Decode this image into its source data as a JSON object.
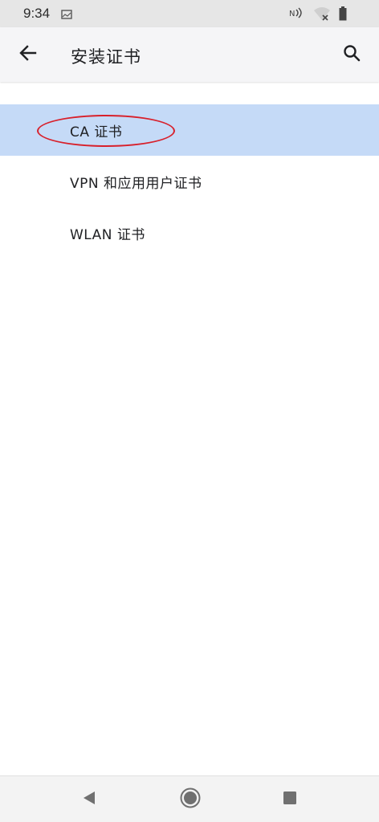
{
  "status_bar": {
    "time": "9:34",
    "icons": [
      "image-icon",
      "nfc-icon",
      "wifi-off-icon",
      "battery-icon"
    ]
  },
  "app_bar": {
    "title": "安装证书",
    "back_icon": "arrow-left-icon",
    "search_icon": "search-icon"
  },
  "list": {
    "items": [
      {
        "label": "CA 证书",
        "selected": true
      },
      {
        "label": "VPN 和应用用户证书",
        "selected": false
      },
      {
        "label": "WLAN 证书",
        "selected": false
      }
    ]
  },
  "nav_bar": {
    "icons": [
      "back-triangle-icon",
      "home-circle-icon",
      "recents-square-icon"
    ]
  },
  "colors": {
    "selected_row": "#c5daf7",
    "annotation": "#d8202b",
    "status_bar": "#e6e6e6",
    "app_bar": "#f5f5f7"
  }
}
